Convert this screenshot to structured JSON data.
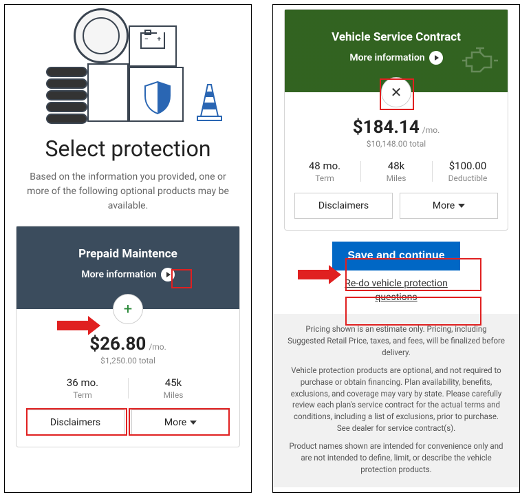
{
  "left": {
    "heading": "Select protection",
    "subtext": "Based on the information you provided, one or more of the following optional products may be available.",
    "card": {
      "title": "Prepaid Maintence",
      "more_info": "More information",
      "price": "$26.80",
      "per_mo": "/mo.",
      "total": "$1,250.00 total",
      "spec1_val": "36 mo.",
      "spec1_lab": "Term",
      "spec2_val": "45k",
      "spec2_lab": "Miles",
      "disclaimers_btn": "Disclaimers",
      "more_btn": "More"
    }
  },
  "right": {
    "card": {
      "title": "Vehicle Service Contract",
      "more_info": "More information",
      "price": "$184.14",
      "per_mo": "/mo.",
      "total": "$10,148.00 total",
      "spec1_val": "48 mo.",
      "spec1_lab": "Term",
      "spec2_val": "48k",
      "spec2_lab": "Miles",
      "spec3_val": "$100.00",
      "spec3_lab": "Deductible",
      "disclaimers_btn": "Disclaimers",
      "more_btn": "More"
    },
    "save_btn": "Save and continue",
    "redo_link": "Re-do vehicle protection questions",
    "fine1": "Pricing shown is an estimate only. Pricing, including Suggested Retail Price, taxes, and fees, will be finalized before delivery.",
    "fine2": "Vehicle protection products are optional, and not required to purchase or obtain financing. Plan availability, benefits, exclusions, and coverage may vary by state. Please carefully review each plan's service contract for the actual terms and conditions, including a list of exclusions, prior to purchase. See dealer for service contract(s).",
    "fine3": "Product names shown are intended for convenience only and are not intended to define, limit, or describe the vehicle protection products."
  }
}
